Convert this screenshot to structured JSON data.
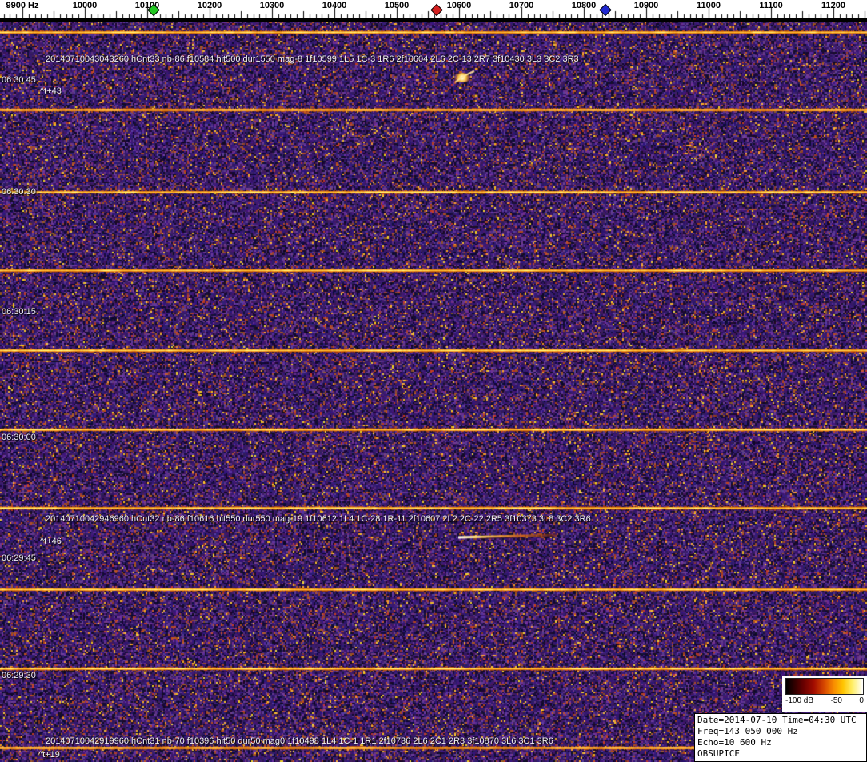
{
  "ruler": {
    "unit": "Hz",
    "labels": [
      "9900 Hz",
      "10000",
      "10100",
      "10200",
      "10300",
      "10400",
      "10500",
      "10600",
      "10700",
      "10800",
      "10900",
      "11000",
      "11100",
      "11200"
    ],
    "markers": [
      {
        "name": "green",
        "color": "#22c822"
      },
      {
        "name": "red",
        "color": "#d42020"
      },
      {
        "name": "blue",
        "color": "#2028d0"
      }
    ]
  },
  "timestamps": [
    "06:30:45",
    "06:30:30",
    "06:30:15",
    "06:30:00",
    "06:29:45",
    "06:29:30"
  ],
  "annotations": [
    {
      "text": "20140710043043260 hCnt33 nb-86 f10584 hit500 dur1550 mag-8 1f10599 1L5 1C-3 1R6 2f10604 2L6 2C-13 2R7 3f10430 3L3 3C2 3R3",
      "tag": "^t+43"
    },
    {
      "text": "20140710042946960 hCnt32 nb-86 f10616 hit550 dur550 mag-19 1f10612 1L4 1C-28 1R-11 2f10607 2L2 2C-22 2R5 3f10373 3L8 3C2 3R6",
      "tag": "^t+46"
    },
    {
      "text": "20140710042919960 hCnt31 nb-70 f10396 hit50 dur50 mag0 1f10498 1L4 1C-1 1R1 2f10736 2L6 2C1 2R3 3f10870 3L6 3C1 3R6",
      "tag": "^t+19"
    }
  ],
  "legend": {
    "labels": [
      "-100 dB",
      "-50",
      "0"
    ]
  },
  "info_box": {
    "date_time": "Date=2014-07-10 Time=04:30 UTC",
    "frequency": "Freq=143 050 000 Hz",
    "echo": "Echo=10 600 Hz",
    "station": "OBSUPICE"
  },
  "colors": {
    "noise_base": "#3a1f6b",
    "band": "#ffb347"
  }
}
